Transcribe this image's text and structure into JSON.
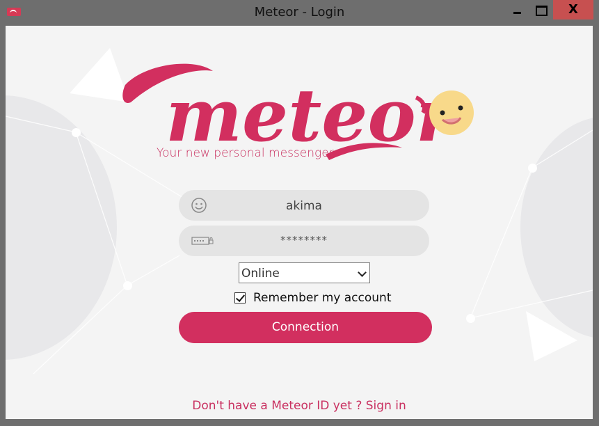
{
  "window": {
    "title": "Meteor - Login",
    "close_glyph": "X"
  },
  "brand": {
    "logo_text": "meteor",
    "tagline": "Your new personal messenger",
    "accent_color": "#d22f5f"
  },
  "login": {
    "username": "akima",
    "password_masked": "********",
    "username_icon": "smiley-icon",
    "password_icon": "password-keyboard-icon",
    "status_selected": "Online",
    "remember_label": "Remember my account",
    "remember_checked": true,
    "connect_label": "Connection"
  },
  "footer": {
    "signup_text": "Don't have a Meteor ID yet ? Sign in"
  }
}
